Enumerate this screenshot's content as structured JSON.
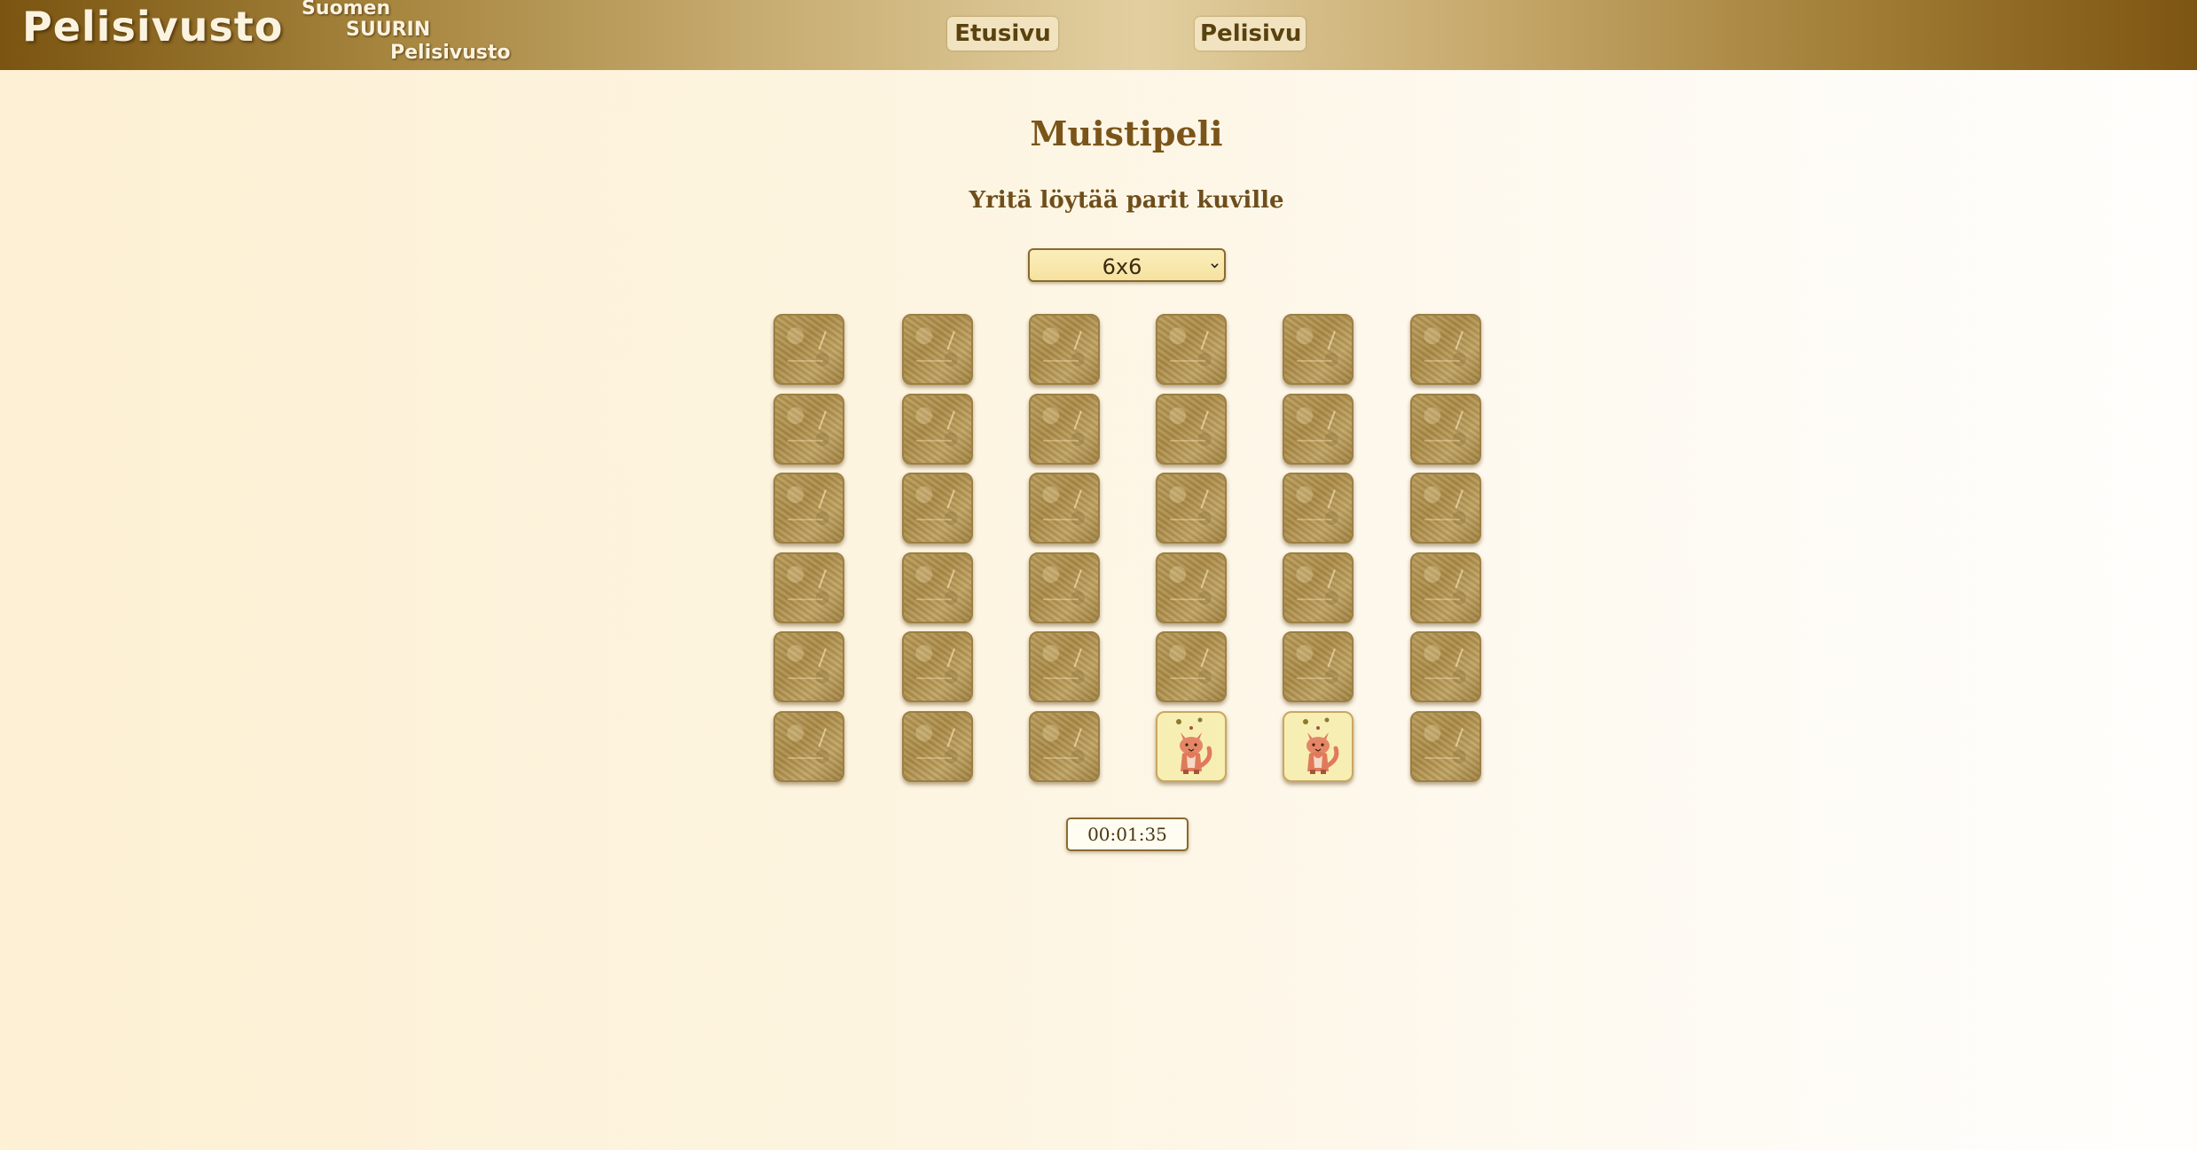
{
  "header": {
    "logo": "Pelisivusto",
    "tagline": [
      "Suomen",
      "SUURIN",
      "Pelisivusto"
    ],
    "nav": [
      {
        "label": "Etusivu"
      },
      {
        "label": "Pelisivu"
      }
    ]
  },
  "main": {
    "title": "Muistipeli",
    "subtitle": "Yritä löytää parit kuville",
    "size_select": {
      "value": "6x6"
    },
    "timer": "00:01:35"
  },
  "board": {
    "rows": 6,
    "cols": 6,
    "revealed": [
      {
        "row": 6,
        "col": 4,
        "image": "fox-icon"
      },
      {
        "row": 6,
        "col": 5,
        "image": "fox-icon"
      }
    ],
    "card_back_image": "card-back-texture"
  },
  "colors": {
    "header_dark": "#7a5410",
    "header_light": "#e2cfa0",
    "title": "#7a5419",
    "card_back": "#b59a5b",
    "card_face": "#f7eeb3",
    "fox": "#e07a5a"
  }
}
